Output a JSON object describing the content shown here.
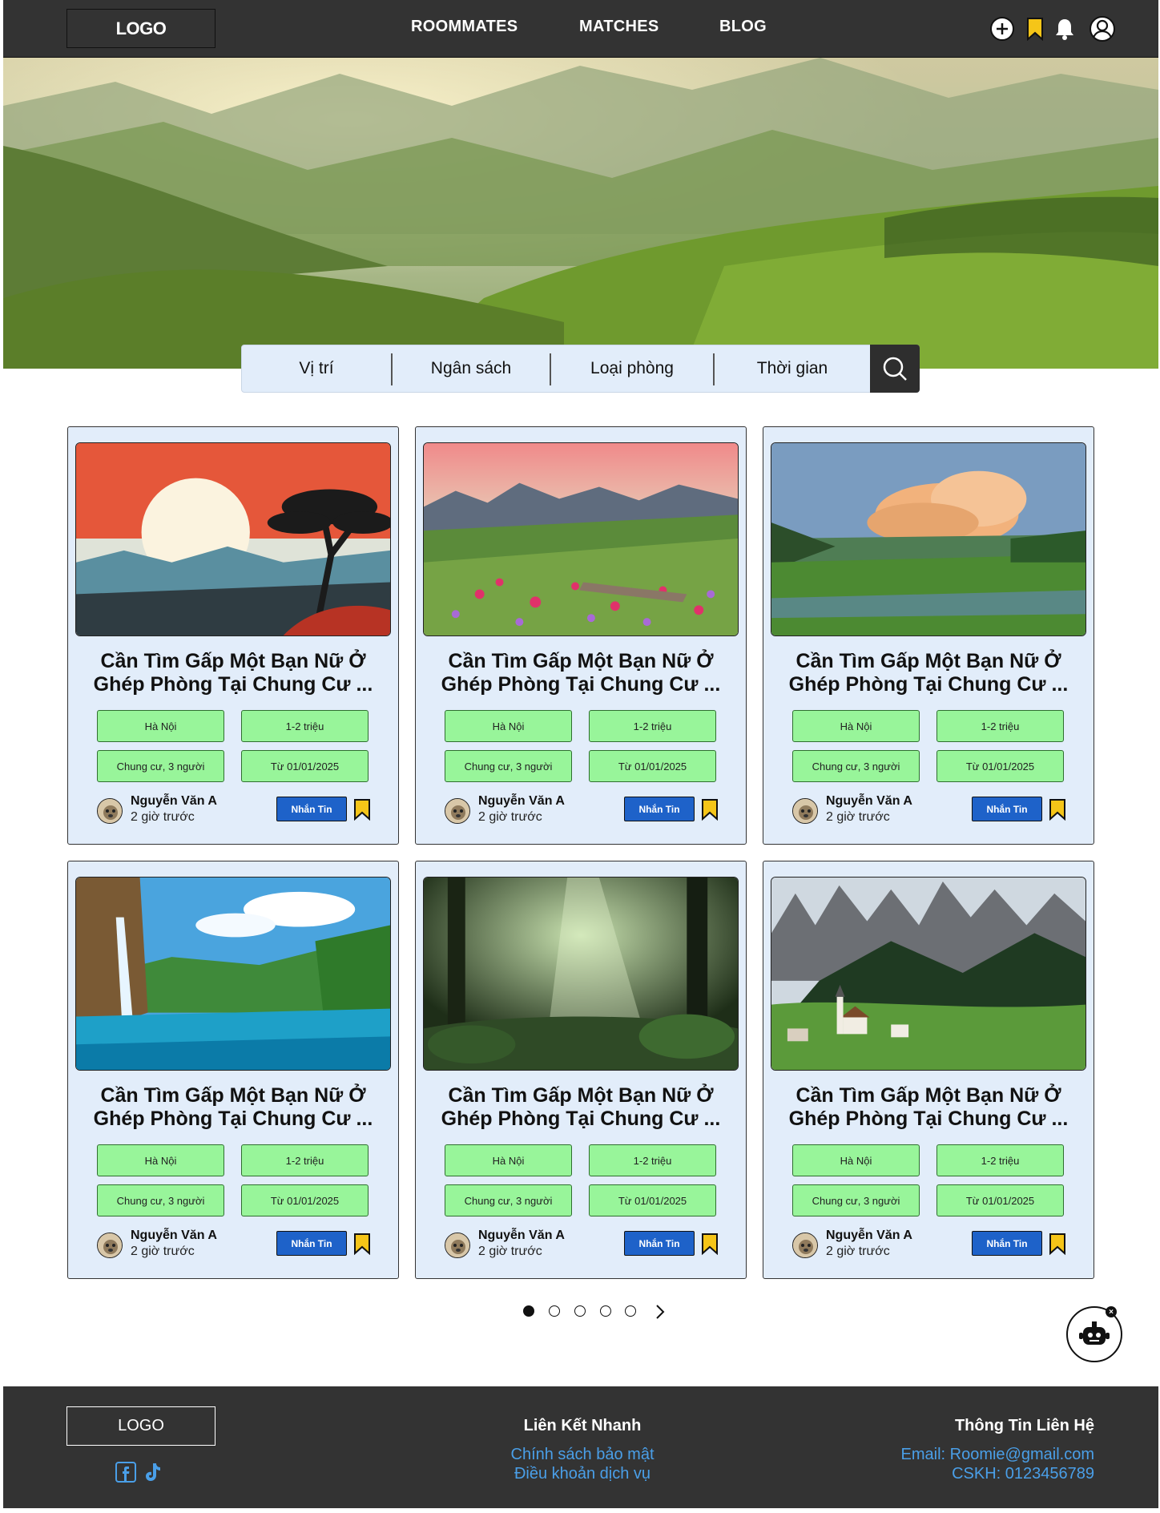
{
  "header": {
    "logo": "LOGO",
    "nav": [
      "ROOMMATES",
      "MATCHES",
      "BLOG"
    ]
  },
  "search": {
    "fields": [
      "Vị trí",
      "Ngân sách",
      "Loại phòng",
      "Thời gian"
    ]
  },
  "cards": [
    {
      "title": "Cần Tìm Gấp Một Bạn Nữ Ở Ghép Phòng Tại Chung Cư ...",
      "location": "Hà Nội",
      "budget": "1-2 triệu",
      "room": "Chung cư, 3 người",
      "date": "Từ 01/01/2025",
      "author": "Nguyễn Văn A",
      "time": "2 giờ trước",
      "button": "Nhắn Tin",
      "image": "sunset-tree"
    },
    {
      "title": "Cần Tìm Gấp Một Bạn Nữ Ở Ghép Phòng Tại Chung Cư ...",
      "location": "Hà Nội",
      "budget": "1-2 triệu",
      "room": "Chung cư, 3 người",
      "date": "Từ 01/01/2025",
      "author": "Nguyễn Văn A",
      "time": "2 giờ trước",
      "button": "Nhắn Tin",
      "image": "flower-meadow"
    },
    {
      "title": "Cần Tìm Gấp Một Bạn Nữ Ở Ghép Phòng Tại Chung Cư ...",
      "location": "Hà Nội",
      "budget": "1-2 triệu",
      "room": "Chung cư, 3 người",
      "date": "Từ 01/01/2025",
      "author": "Nguyễn Văn A",
      "time": "2 giờ trước",
      "button": "Nhắn Tin",
      "image": "clouds-field"
    },
    {
      "title": "Cần Tìm Gấp Một Bạn Nữ Ở Ghép Phòng Tại Chung Cư ...",
      "location": "Hà Nội",
      "budget": "1-2 triệu",
      "room": "Chung cư, 3 người",
      "date": "Từ 01/01/2025",
      "author": "Nguyễn Văn A",
      "time": "2 giờ trước",
      "button": "Nhắn Tin",
      "image": "waterfall-lake"
    },
    {
      "title": "Cần Tìm Gấp Một Bạn Nữ Ở Ghép Phòng Tại Chung Cư ...",
      "location": "Hà Nội",
      "budget": "1-2 triệu",
      "room": "Chung cư, 3 người",
      "date": "Từ 01/01/2025",
      "author": "Nguyễn Văn A",
      "time": "2 giờ trước",
      "button": "Nhắn Tin",
      "image": "jungle-light"
    },
    {
      "title": "Cần Tìm Gấp Một Bạn Nữ Ở Ghép Phòng Tại Chung Cư ...",
      "location": "Hà Nội",
      "budget": "1-2 triệu",
      "room": "Chung cư, 3 người",
      "date": "Từ 01/01/2025",
      "author": "Nguyễn Văn A",
      "time": "2 giờ trước",
      "button": "Nhắn Tin",
      "image": "alpine-village"
    }
  ],
  "pagination": {
    "pages": 5,
    "current": 1,
    "next_icon": "chevron-right-icon"
  },
  "footer": {
    "logo": "LOGO",
    "links_title": "Liên Kết Nhanh",
    "links": [
      "Chính sách bảo mật",
      "Điều khoản dịch vụ"
    ],
    "contact_title": "Thông Tin Liên Hệ",
    "contact": [
      "Email: Roomie@gmail.com",
      "CSKH: 0123456789"
    ],
    "socials": [
      "facebook-icon",
      "tiktok-icon"
    ]
  },
  "colors": {
    "header_bg": "#333333",
    "tag_bg": "#98f59a",
    "card_bg": "#e2edfa",
    "button_bg": "#1e62c9",
    "bookmark": "#f5c518",
    "link": "#4a9fe8"
  }
}
